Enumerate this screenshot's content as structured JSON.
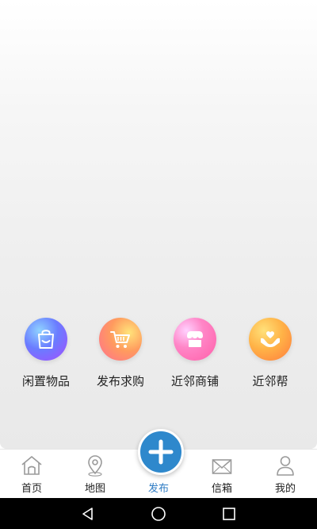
{
  "actions": [
    {
      "label": "闲置物品",
      "icon": "shopping-bag-icon"
    },
    {
      "label": "发布求购",
      "icon": "shopping-cart-icon"
    },
    {
      "label": "近邻商铺",
      "icon": "shop-icon"
    },
    {
      "label": "近邻帮",
      "icon": "helping-hands-icon"
    }
  ],
  "tabs": [
    {
      "label": "首页",
      "icon": "home-icon"
    },
    {
      "label": "地图",
      "icon": "map-pin-icon"
    },
    {
      "label": "发布",
      "icon": "plus-icon",
      "active": true
    },
    {
      "label": "信箱",
      "icon": "mail-icon"
    },
    {
      "label": "我的",
      "icon": "user-icon"
    }
  ],
  "colors": {
    "accent": "#2e88cc",
    "active_tab_text": "#2f7cc4",
    "nav_bar": "#000000"
  }
}
